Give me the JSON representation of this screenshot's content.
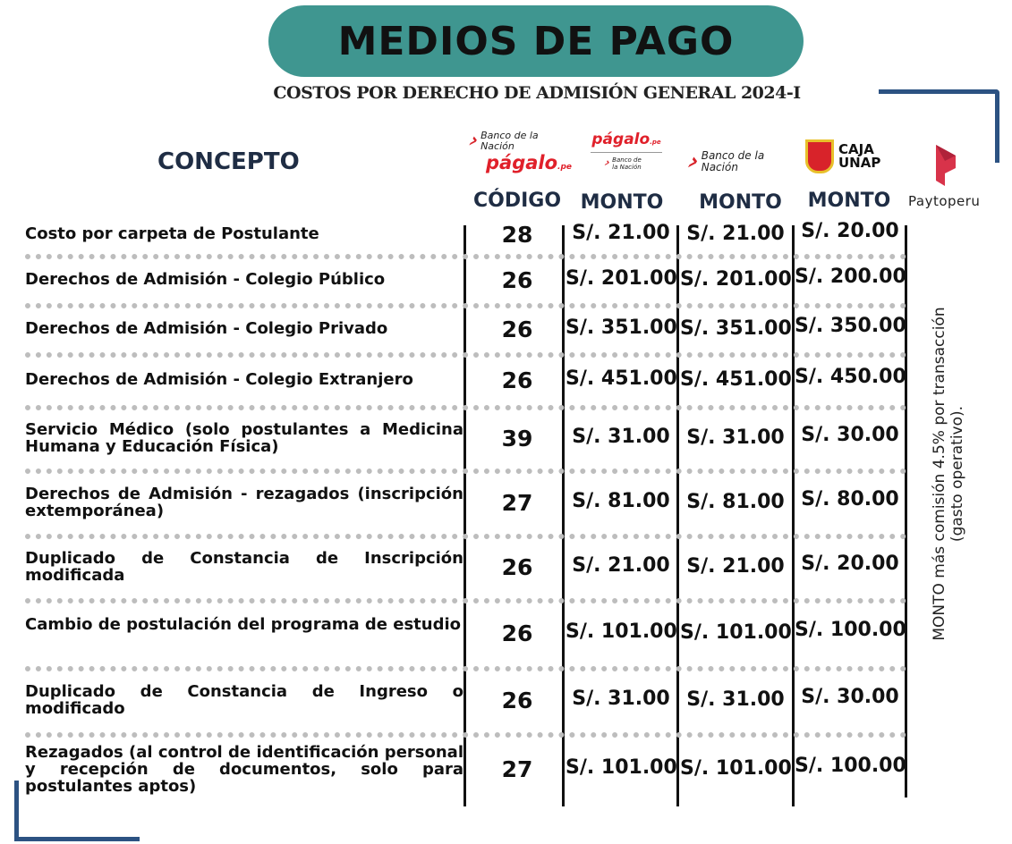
{
  "header": {
    "title": "MEDIOS DE PAGO",
    "subtitle": "COSTOS POR DERECHO DE ADMISIÓN GENERAL 2024-I"
  },
  "columns": {
    "concept": "CONCEPTO",
    "code": "CÓDIGO",
    "monto": "MONTO",
    "logos": {
      "banco_nacion": "Banco de la Nación",
      "pagalo": "págalo",
      "pagalo_suffix": ".pe",
      "caja_unap": "CAJA UNAP",
      "paytoperu": "Paytoperu"
    }
  },
  "rows": [
    {
      "concept": "Costo por carpeta de Postulante",
      "code": "28",
      "bn": "S/. 21.00",
      "pagalo": "S/. 21.00",
      "caja": "S/. 20.00"
    },
    {
      "concept": "Derechos de Admisión - Colegio Público",
      "code": "26",
      "bn": "S/. 201.00",
      "pagalo": "S/. 201.00",
      "caja": "S/. 200.00"
    },
    {
      "concept": "Derechos de Admisión - Colegio Privado",
      "code": "26",
      "bn": "S/. 351.00",
      "pagalo": "S/. 351.00",
      "caja": "S/. 350.00"
    },
    {
      "concept": "Derechos de Admisión - Colegio Extranjero",
      "code": "26",
      "bn": "S/. 451.00",
      "pagalo": "S/. 451.00",
      "caja": "S/. 450.00"
    },
    {
      "concept": "Servicio Médico (solo postulantes a Medicina Humana y Educación Física)",
      "code": "39",
      "bn": "S/. 31.00",
      "pagalo": "S/. 31.00",
      "caja": "S/. 30.00"
    },
    {
      "concept": "Derechos de Admisión - rezagados (inscripción extemporánea)",
      "code": "27",
      "bn": "S/. 81.00",
      "pagalo": "S/. 81.00",
      "caja": "S/. 80.00"
    },
    {
      "concept": "Duplicado de Constancia de Inscripción modificada",
      "code": "26",
      "bn": "S/. 21.00",
      "pagalo": "S/. 21.00",
      "caja": "S/. 20.00"
    },
    {
      "concept": "Cambio de postulación del programa de estudio",
      "code": "26",
      "bn": "S/. 101.00",
      "pagalo": "S/. 101.00",
      "caja": "S/. 100.00"
    },
    {
      "concept": "Duplicado de Constancia de Ingreso o modificado",
      "code": "26",
      "bn": "S/. 31.00",
      "pagalo": "S/. 31.00",
      "caja": "S/. 30.00"
    },
    {
      "concept": "Rezagados (al control de identificación personal y recepción de documentos, solo para postulantes aptos)",
      "code": "27",
      "bn": "S/. 101.00",
      "pagalo": "S/. 101.00",
      "caja": "S/. 100.00"
    }
  ],
  "side_note": "MONTO más comisión 4.5% por transacción (gasto operativo).",
  "colors": {
    "teal": "#3f9690",
    "navy": "#2c5282",
    "red": "#d8232a"
  }
}
